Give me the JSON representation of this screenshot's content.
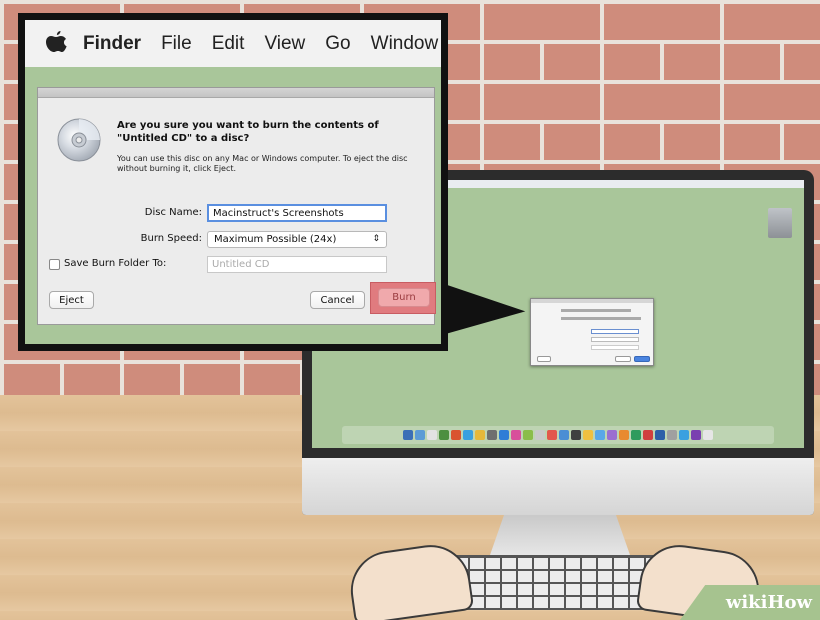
{
  "menubar": {
    "app_name": "Finder",
    "items": [
      "File",
      "Edit",
      "View",
      "Go",
      "Window"
    ]
  },
  "dialog": {
    "title": "Are you sure you want to burn the contents of \"Untitled CD\" to a disc?",
    "description": "You can use this disc on any Mac or Windows computer. To eject the disc without burning it, click Eject.",
    "disc_name_label": "Disc Name:",
    "disc_name_value": "Macinstruct's Screenshots",
    "burn_speed_label": "Burn Speed:",
    "burn_speed_value": "Maximum Possible (24x)",
    "save_folder_label": "Save Burn Folder To:",
    "save_folder_placeholder": "Untitled CD",
    "save_folder_checked": false,
    "eject_button": "Eject",
    "cancel_button": "Cancel",
    "burn_button": "Burn",
    "burn_highlight_color": "#e07b7f"
  },
  "colors": {
    "desktop_green": "#a9c69a",
    "brick": "#cf8c7c",
    "mortar": "#e9e2db"
  },
  "icons": {
    "apple": "apple-logo-icon",
    "disc": "cd-disc-icon"
  },
  "watermark": {
    "wiki": "wiki",
    "how": "How"
  }
}
